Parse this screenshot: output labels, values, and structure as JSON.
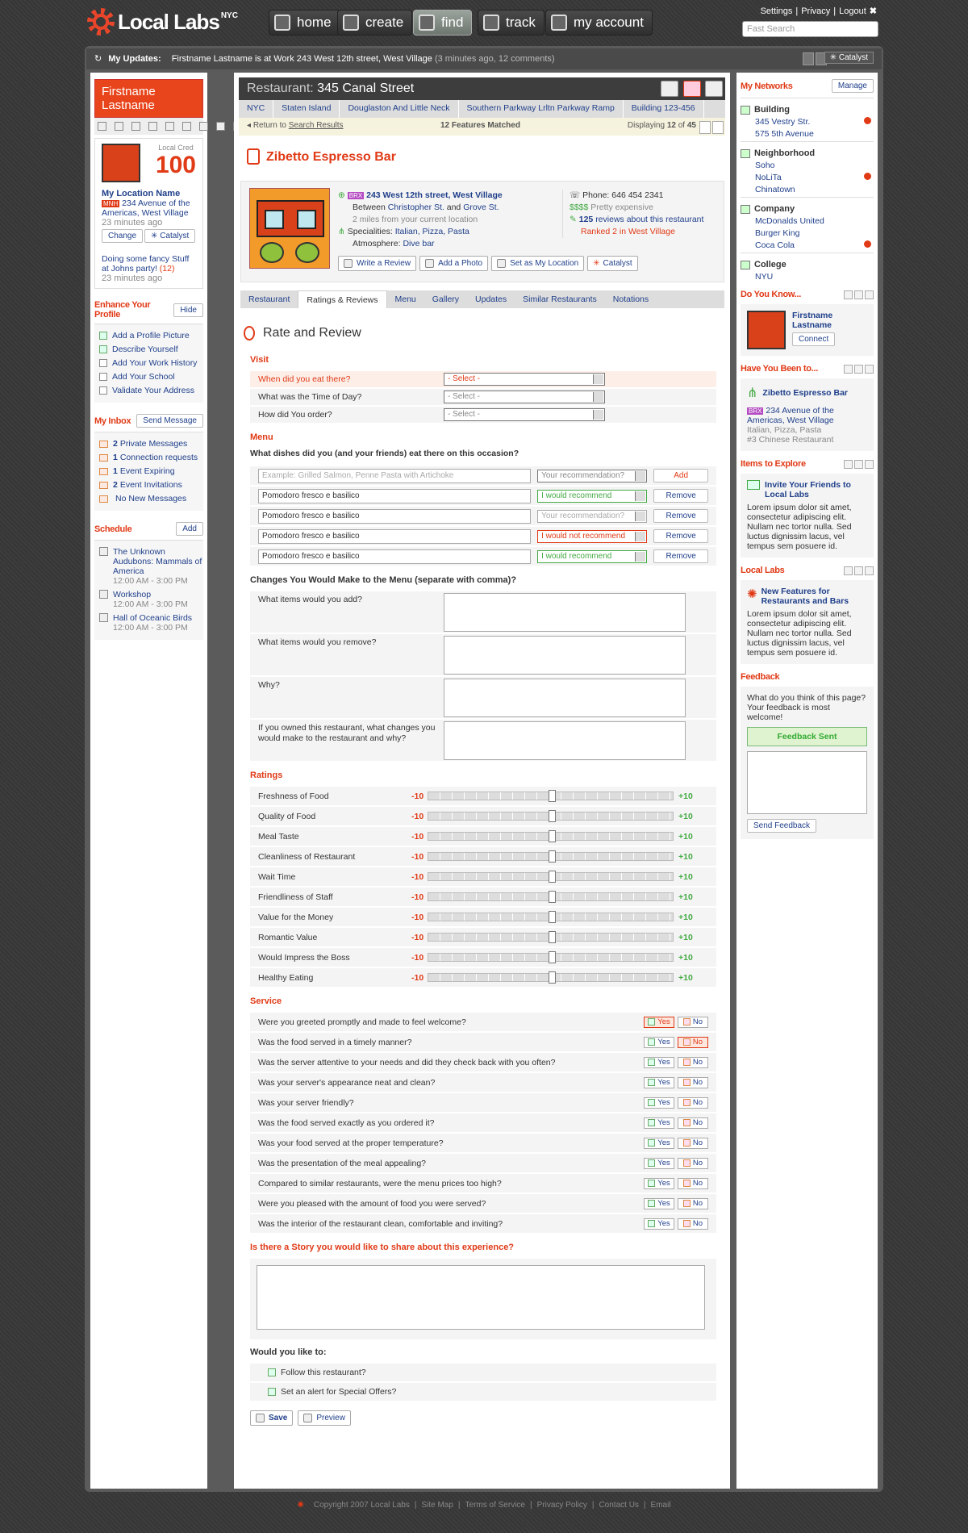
{
  "nav": {
    "brand": "Local Labs",
    "brand_sup": "NYC",
    "items": [
      "home",
      "create",
      "find",
      "track",
      "my account"
    ],
    "active": "find"
  },
  "toplinks": [
    "Settings",
    "Privacy",
    "Logout"
  ],
  "search_placeholder": "Fast Search",
  "updates": {
    "label": "My Updates:",
    "text": "Firstname Lastname is at Work 243 West 12th street, West Village",
    "meta": "(3 minutes ago, 12 comments)",
    "catalyst": "Catalyst"
  },
  "profile": {
    "name": "Firstname Lastname",
    "cred_label": "Local Cred",
    "cred": "100",
    "loc_title": "My Location Name",
    "loc_badge": "MNH",
    "loc_addr": "234 Avenue of the Americas, West Village",
    "loc_time": "23 minutes ago",
    "change": "Change",
    "catalyst": "Catalyst",
    "status": "Doing some fancy Stuff at Johns party!",
    "status_count": "(12)",
    "status_time": "23 minutes ago"
  },
  "enhance": {
    "title": "Enhance Your Profile",
    "hide": "Hide",
    "items": [
      {
        "t": "Add a Profile Picture",
        "done": true
      },
      {
        "t": "Describe Yourself",
        "done": true
      },
      {
        "t": "Add Your Work History",
        "done": false
      },
      {
        "t": "Add Your School",
        "done": false
      },
      {
        "t": "Validate Your Address",
        "done": false
      }
    ]
  },
  "inbox": {
    "title": "My Inbox",
    "btn": "Send Message",
    "items": [
      {
        "n": "2",
        "t": "Private Messages"
      },
      {
        "n": "1",
        "t": "Connection requests"
      },
      {
        "n": "1",
        "t": "Event Expiring"
      },
      {
        "n": "2",
        "t": "Event Invitations"
      },
      {
        "n": "",
        "t": "No New Messages"
      }
    ]
  },
  "schedule": {
    "title": "Schedule",
    "btn": "Add",
    "items": [
      {
        "t": "The Unknown Audubons: Mammals of America",
        "time": "12:00 AM - 3:00 PM"
      },
      {
        "t": "Workshop",
        "time": "12:00 AM - 3:00 PM"
      },
      {
        "t": "Hall of Oceanic Birds",
        "time": "12:00 AM - 3:00 PM"
      }
    ]
  },
  "main": {
    "title_pre": "Restaurant:",
    "title": "345 Canal Street",
    "crumbs": [
      "NYC",
      "Staten Island",
      "Douglaston And Little Neck",
      "Southern Parkway Lrltn Parkway Ramp",
      "Building 123-456"
    ],
    "return": "Return to",
    "return_link": "Search Results",
    "matched": "12 Features Matched",
    "displaying": "Displaying",
    "disp_n": "12",
    "disp_of": "of",
    "disp_total": "45",
    "venue": "Zibetto Espresso Bar",
    "badge": "BRX",
    "addr": "243 West 12th street, West Village",
    "between": "Between",
    "st1": "Christopher St.",
    "and": "and",
    "st2": "Grove St.",
    "distance": "2 miles from your current location",
    "spec_label": "Specialities:",
    "spec": "Italian, Pizza, Pasta",
    "atm_label": "Atmosphere:",
    "atm": "Dive bar",
    "phone": "Phone: 646 454 2341",
    "price": "Pretty expensive",
    "reviews_n": "125",
    "reviews": "reviews about this restaurant",
    "ranked": "Ranked 2 in West Village",
    "actions": [
      "Write a Review",
      "Add a Photo",
      "Set as My Location",
      "Catalyst"
    ],
    "tabs": [
      "Restaurant",
      "Ratings & Reviews",
      "Menu",
      "Gallery",
      "Updates",
      "Similar Restaurants",
      "Notations"
    ],
    "active_tab": "Ratings & Reviews"
  },
  "form": {
    "heading": "Rate and Review",
    "visit": "Visit",
    "visit_rows": [
      {
        "q": "When did you eat there?",
        "v": "- Select -"
      },
      {
        "q": "What was the Time of Day?",
        "v": "- Select -"
      },
      {
        "q": "How did You order?",
        "v": "- Select -"
      }
    ],
    "menu": "Menu",
    "menu_q": "What dishes did you (and your friends) eat there on this occasion?",
    "dish_ph": "Example: Grilled Salmon, Penne Pasta with Artichoke",
    "rec_ph": "Your recommendation?",
    "add": "Add",
    "dishes": [
      {
        "d": "Pomodoro fresco e basilico",
        "r": "I would recommend",
        "state": "good"
      },
      {
        "d": "Pomodoro fresco e basilico",
        "r": "Your recommendation?",
        "state": "none"
      },
      {
        "d": "Pomodoro fresco e basilico",
        "r": "I would not recommend",
        "state": "bad"
      },
      {
        "d": "Pomodoro fresco e basilico",
        "r": "I would recommend",
        "state": "good"
      }
    ],
    "remove": "Remove",
    "changes": "Changes You Would Make to the Menu (separate with comma)?",
    "change_qs": [
      "What items would you add?",
      "What items would you remove?",
      "Why?",
      "If you owned this restaurant, what changes you would make to the restaurant and why?"
    ],
    "ratings": "Ratings",
    "min": "-10",
    "max": "+10",
    "rating_items": [
      "Freshness of Food",
      "Quality of Food",
      "Meal Taste",
      "Cleanliness of Restaurant",
      "Wait Time",
      "Friendliness of Staff",
      "Value for the Money",
      "Romantic Value",
      "Would Impress the Boss",
      "Healthy Eating"
    ],
    "service": "Service",
    "yes": "Yes",
    "no": "No",
    "service_items": [
      {
        "q": "Were you greeted promptly and made to feel welcome?",
        "sel": "yes"
      },
      {
        "q": "Was the food served in a timely manner?",
        "sel": "no"
      },
      {
        "q": "Was the server attentive to your needs and did they check back with you often?",
        "sel": ""
      },
      {
        "q": "Was your server's appearance neat and clean?",
        "sel": ""
      },
      {
        "q": "Was your server friendly?",
        "sel": ""
      },
      {
        "q": "Was the food served exactly as you ordered it?",
        "sel": ""
      },
      {
        "q": "Was your food served at the proper temperature?",
        "sel": ""
      },
      {
        "q": "Was the presentation of the meal appealing?",
        "sel": ""
      },
      {
        "q": "Compared to similar restaurants, were the menu prices too high?",
        "sel": ""
      },
      {
        "q": "Were you pleased with the amount of food you were served?",
        "sel": ""
      },
      {
        "q": "Was the interior of the restaurant clean, comfortable and inviting?",
        "sel": ""
      }
    ],
    "story": "Is there a Story you would like to share about this experience?",
    "wouldlike": "Would you like to:",
    "opts": [
      "Follow this restaurant?",
      "Set an alert for Special Offers?"
    ],
    "save": "Save",
    "preview": "Preview"
  },
  "right": {
    "networks": "My Networks",
    "manage": "Manage",
    "groups": [
      {
        "g": "Building",
        "items": [
          {
            "t": "345 Vestry Str.",
            "a": true
          },
          {
            "t": "575 5th Avenue",
            "a": false
          }
        ]
      },
      {
        "g": "Neighborhood",
        "items": [
          {
            "t": "Soho",
            "a": false
          },
          {
            "t": "NoLiTa",
            "a": true
          },
          {
            "t": "Chinatown",
            "a": false
          }
        ]
      },
      {
        "g": "Company",
        "items": [
          {
            "t": "McDonalds United",
            "a": false
          },
          {
            "t": "Burger King",
            "a": false
          },
          {
            "t": "Coca Cola",
            "a": true
          }
        ]
      },
      {
        "g": "College",
        "items": [
          {
            "t": "NYU",
            "a": false
          }
        ]
      }
    ],
    "know": "Do You Know...",
    "know_name": "Firstname Lastname",
    "connect": "Connect",
    "been": "Have You Been to...",
    "been_name": "Zibetto Espresso Bar",
    "been_badge": "BRX",
    "been_addr": "234 Avenue of the Americas, West Village",
    "been_spec": "Italian, Pizza, Pasta",
    "been_rank": "#3 Chinese Restaurant",
    "explore": "Items to Explore",
    "invite": "Invite Your Friends to Local Labs",
    "lorem": "Lorem ipsum dolor sit amet, consectetur adipiscing elit. Nullam nec tortor nulla. Sed luctus dignissim lacus, vel tempus sem posuere id.",
    "ll": "Local Labs",
    "newf": "New Features for Restaurants and Bars",
    "feedback": "Feedback",
    "fb_q": "What do you think of this page? Your feedback is most welcome!",
    "fb_sent": "Feedback Sent",
    "fb_send": "Send Feedback"
  },
  "footer": [
    "Copyright 2007 Local Labs",
    "Site Map",
    "Terms of Service",
    "Privacy Policy",
    "Contact Us",
    "Email"
  ]
}
